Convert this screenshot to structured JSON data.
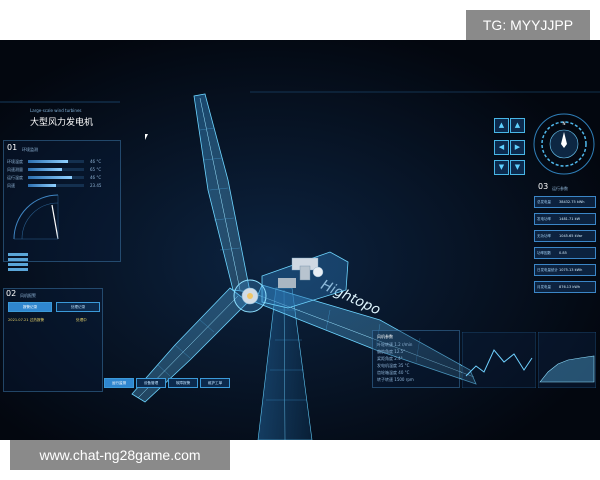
{
  "overlays": {
    "tg_label": "TG: MYYJJPP",
    "site_label": "www.chat-ng28game.com"
  },
  "header": {
    "subtitle": "Large-scale wind turbines",
    "title": "大型风力发电机"
  },
  "panel01": {
    "number": "01",
    "title": "环境监测",
    "rows": [
      {
        "label": "环境温度",
        "value": "46 °C",
        "fraction": 0.72
      },
      {
        "label": "风速测量",
        "value": "65 °C",
        "fraction": 0.6
      },
      {
        "label": "运行温度",
        "value": "46 °C",
        "fraction": 0.78
      },
      {
        "label": "风速",
        "value": "23.45",
        "fraction": 0.5
      }
    ]
  },
  "panel02": {
    "number": "02",
    "title": "风机报警",
    "tab_active": "报警记录",
    "tab_other": "处理记录",
    "row_text": "2021.07.21 过热报警",
    "row_status": "处理中"
  },
  "panel03": {
    "number": "03",
    "title": "运行参数",
    "items": [
      {
        "label": "总发电量",
        "value": "38432.75 kWh"
      },
      {
        "label": "发电功率",
        "value": "1481.71 kW"
      },
      {
        "label": "无功功率",
        "value": "1045.65 kVar"
      },
      {
        "label": "功率因数",
        "value": "0.85"
      },
      {
        "label": "日发电量统计",
        "value": "1075.13 kWh"
      },
      {
        "label": "月发电量",
        "value": "876.13 kWh"
      }
    ]
  },
  "bottom_nav": [
    "运行监测",
    "设备管理",
    "故障报警",
    "维护工单"
  ],
  "wind_blade_text": "Hightopo",
  "callout": {
    "header": "风机参数",
    "rows": [
      "叶轮转速 1.2 r/min",
      "偏航角度 12.5°",
      "桨距角度 2.4°",
      "发电机温度 35 °C",
      "齿轮箱温度 40 °C",
      "转子转速 1500 rpm"
    ]
  },
  "compass_label": "N",
  "colors": {
    "accent": "#2f86cf",
    "glow": "#5fd1ff",
    "background": "#03070f"
  }
}
